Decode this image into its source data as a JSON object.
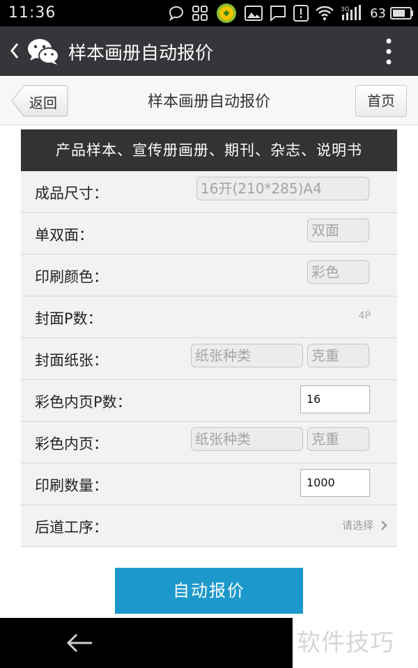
{
  "status_bar": {
    "time": "11:36",
    "battery_level": "63",
    "icons": [
      "chat-bubble-icon",
      "grid-icon",
      "app-badge-icon",
      "image-icon",
      "message-icon",
      "alert-icon",
      "wifi-icon",
      "3g-signal-icon",
      "battery-icon"
    ]
  },
  "wechat_header": {
    "title": "样本画册自动报价"
  },
  "page_nav": {
    "back_label": "返回",
    "title": "样本画册自动报价",
    "home_label": "首页"
  },
  "form": {
    "header": "产品样本、宣传册画册、期刊、杂志、说明书",
    "rows": [
      {
        "label": "成品尺寸：",
        "value": "16开(210*285)A4"
      },
      {
        "label": "单双面：",
        "value": "双面"
      },
      {
        "label": "印刷颜色：",
        "value": "彩色"
      },
      {
        "label": "封面P数：",
        "value": "4P"
      },
      {
        "label": "封面纸张：",
        "paper": "纸张种类",
        "weight": "克重"
      },
      {
        "label": "彩色内页P数：",
        "value": "16"
      },
      {
        "label": "彩色内页：",
        "paper": "纸张种类",
        "weight": "克重"
      },
      {
        "label": "印刷数量：",
        "value": "1000"
      },
      {
        "label": "后道工序：",
        "value": "请选择"
      }
    ]
  },
  "submit_label": "自动报价",
  "watermark": "软件技巧",
  "colors": {
    "status_bar": "#000000",
    "wechat_header": "#343639",
    "form_header": "#333333",
    "row_bg": "#f2f2f2",
    "submit_button": "#1c98cb"
  }
}
